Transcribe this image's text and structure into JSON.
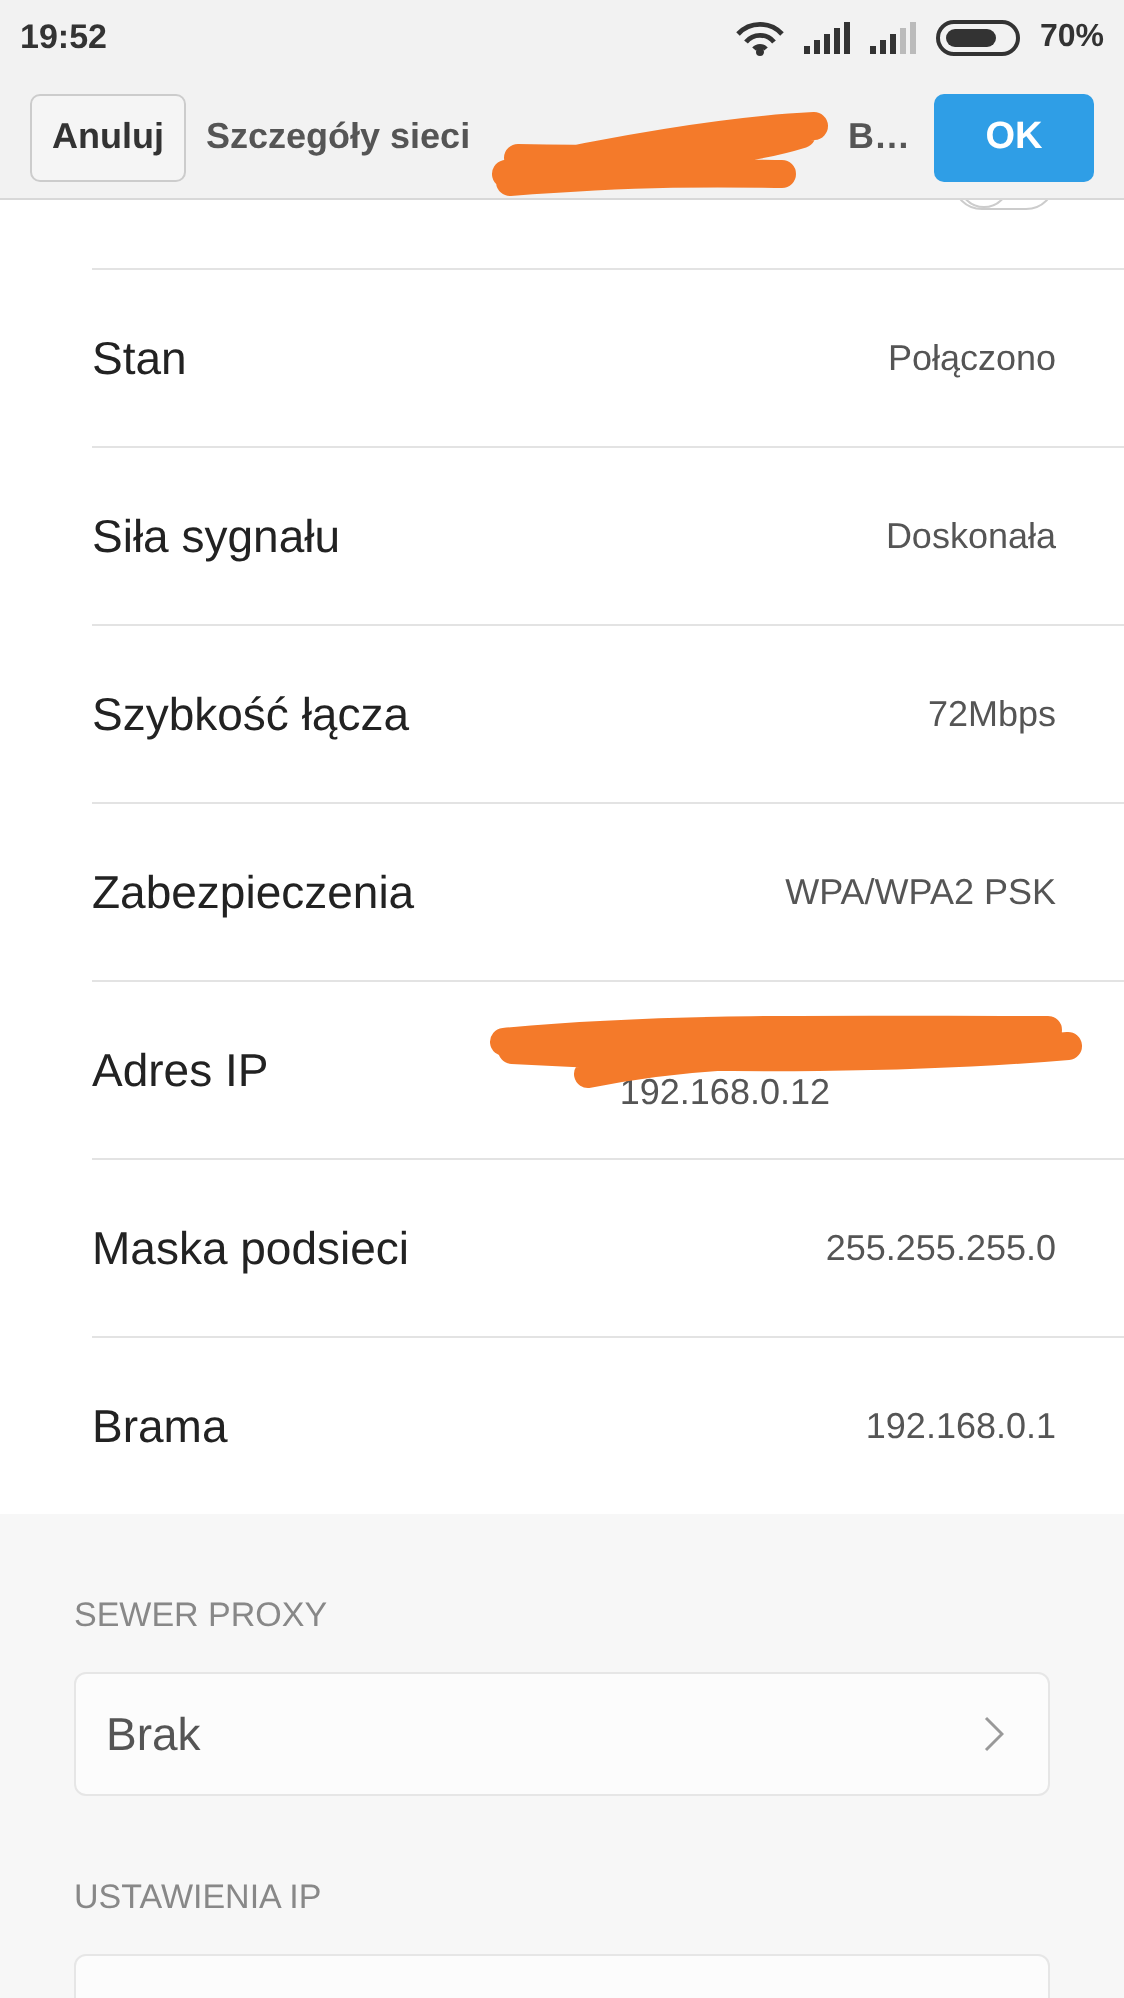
{
  "status_bar": {
    "time": "19:52",
    "battery": "70%"
  },
  "header": {
    "cancel": "Anuluj",
    "title": "Szczegóły sieci",
    "title_end": "B…",
    "ok": "OK"
  },
  "rows": [
    {
      "kind": "toggle",
      "on": false
    },
    {
      "kind": "value",
      "label": "Stan",
      "value": "Połączono"
    },
    {
      "kind": "value",
      "label": "Siła sygnału",
      "value": "Doskonała"
    },
    {
      "kind": "value",
      "label": "Szybkość łącza",
      "value": "72Mbps"
    },
    {
      "kind": "value",
      "label": "Zabezpieczenia",
      "value": "WPA/WPA2 PSK"
    },
    {
      "kind": "redacted",
      "label": "Adres IP",
      "value": "192.168.0.12"
    },
    {
      "kind": "value",
      "label": "Maska podsieci",
      "value": "255.255.255.0"
    },
    {
      "kind": "value",
      "label": "Brama",
      "value": "192.168.0.1"
    }
  ],
  "sections": [
    {
      "title": "SEWER PROXY",
      "value": "Brak"
    },
    {
      "title": "USTAWIENIA IP"
    }
  ]
}
